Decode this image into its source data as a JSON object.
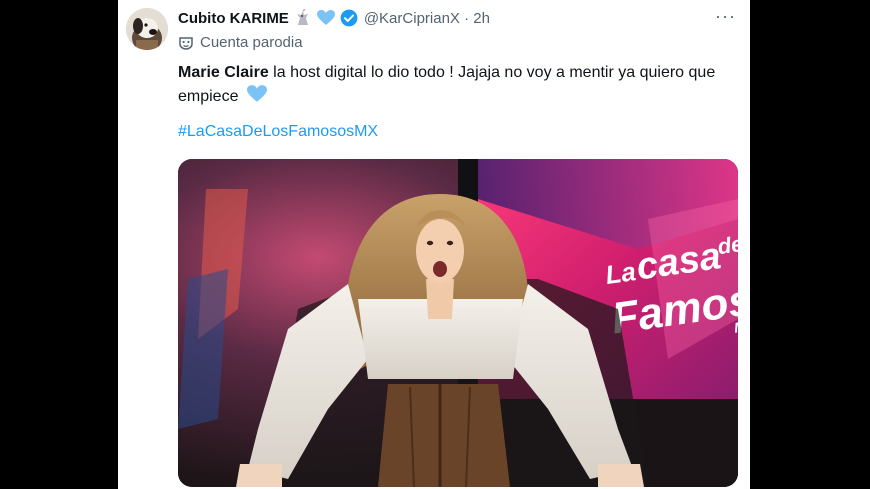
{
  "tweet": {
    "author_name": "Cubito KARIME",
    "handle_time": "@KarCiprianX · 2h",
    "parody_label": "Cuenta parodia",
    "more_label": "···",
    "text_bold": "Marie Claire",
    "text_rest": " la host digital lo dio todo ! Jajaja no voy a mentir ya quiero que empiece",
    "hashtag": "#LaCasaDeLosFamososMX",
    "media_text": {
      "line1": "La",
      "line2": "casa",
      "line3": "de",
      "line4": "Famos",
      "line5": "M"
    }
  },
  "colors": {
    "link_blue": "#1d9bf0",
    "heart_blue": "#7cc3f5",
    "secondary_text": "#536471",
    "primary_text": "#0f1419"
  },
  "icons": [
    "dog-avatar",
    "unicorn-icon",
    "blue-heart-icon",
    "verified-badge-icon",
    "parody-mask-icon",
    "more-options-icon"
  ]
}
